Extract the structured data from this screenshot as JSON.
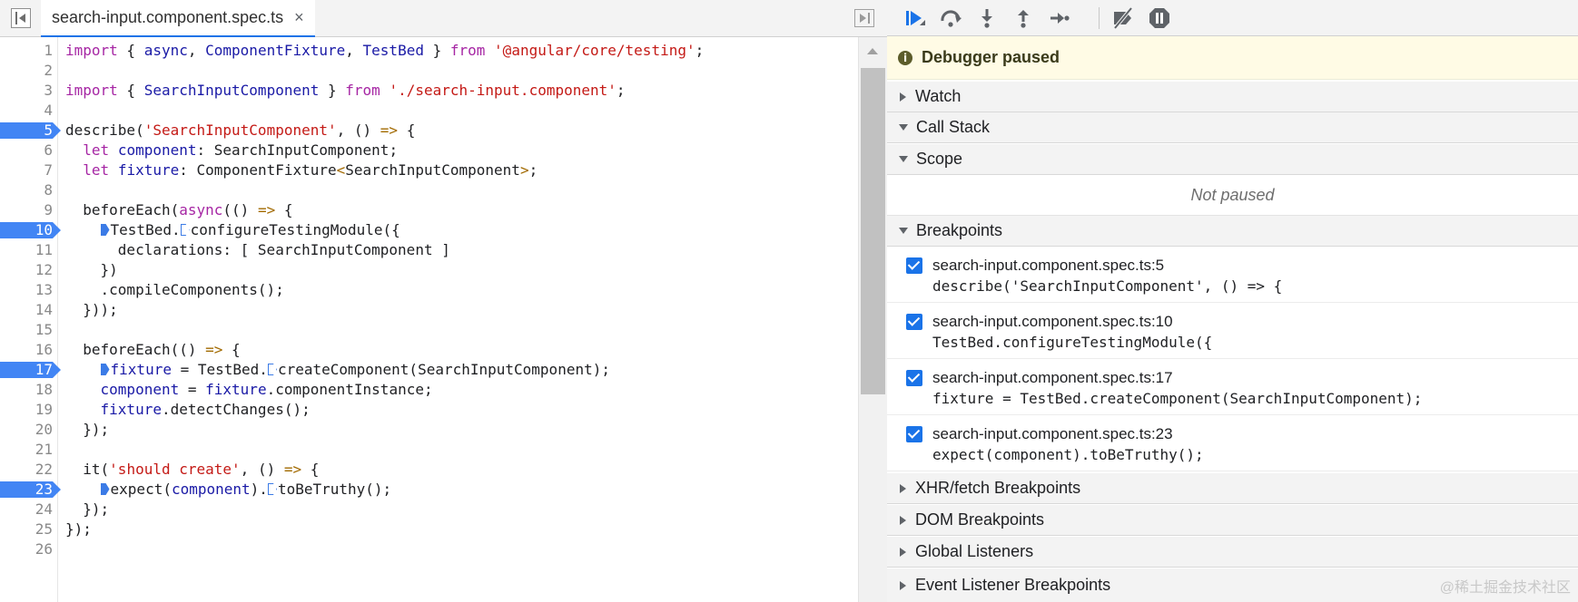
{
  "editor": {
    "tab_name": "search-input.component.spec.ts",
    "close_glyph": "×"
  },
  "code_lines": [
    {
      "n": "1",
      "bp": false
    },
    {
      "n": "2",
      "bp": false
    },
    {
      "n": "3",
      "bp": false
    },
    {
      "n": "4",
      "bp": false
    },
    {
      "n": "5",
      "bp": true
    },
    {
      "n": "6",
      "bp": false
    },
    {
      "n": "7",
      "bp": false
    },
    {
      "n": "8",
      "bp": false
    },
    {
      "n": "9",
      "bp": false
    },
    {
      "n": "10",
      "bp": true
    },
    {
      "n": "11",
      "bp": false
    },
    {
      "n": "12",
      "bp": false
    },
    {
      "n": "13",
      "bp": false
    },
    {
      "n": "14",
      "bp": false
    },
    {
      "n": "15",
      "bp": false
    },
    {
      "n": "16",
      "bp": false
    },
    {
      "n": "17",
      "bp": true
    },
    {
      "n": "18",
      "bp": false
    },
    {
      "n": "19",
      "bp": false
    },
    {
      "n": "20",
      "bp": false
    },
    {
      "n": "21",
      "bp": false
    },
    {
      "n": "22",
      "bp": false
    },
    {
      "n": "23",
      "bp": true
    },
    {
      "n": "24",
      "bp": false
    },
    {
      "n": "25",
      "bp": false
    },
    {
      "n": "26",
      "bp": false
    }
  ],
  "code": {
    "l1": [
      [
        "kw",
        "import"
      ],
      [
        "t",
        " { "
      ],
      [
        "id",
        "async"
      ],
      [
        "t",
        ", "
      ],
      [
        "id",
        "ComponentFixture"
      ],
      [
        "t",
        ", "
      ],
      [
        "id",
        "TestBed"
      ],
      [
        "t",
        " } "
      ],
      [
        "kw",
        "from"
      ],
      [
        "t",
        " "
      ],
      [
        "str",
        "'@angular/core/testing'"
      ],
      [
        "t",
        ";"
      ]
    ],
    "l3": [
      [
        "kw",
        "import"
      ],
      [
        "t",
        " { "
      ],
      [
        "id",
        "SearchInputComponent"
      ],
      [
        "t",
        " } "
      ],
      [
        "kw",
        "from"
      ],
      [
        "t",
        " "
      ],
      [
        "str",
        "'./search-input.component'"
      ],
      [
        "t",
        ";"
      ]
    ],
    "l5": [
      [
        "t",
        "describe("
      ],
      [
        "str",
        "'SearchInputComponent'"
      ],
      [
        "t",
        ", () "
      ],
      [
        "ar",
        "=>"
      ],
      [
        "t",
        " {"
      ]
    ],
    "l6": [
      [
        "t",
        "  "
      ],
      [
        "kw",
        "let"
      ],
      [
        "t",
        " "
      ],
      [
        "id",
        "component"
      ],
      [
        "t",
        ": SearchInputComponent;"
      ]
    ],
    "l7": [
      [
        "t",
        "  "
      ],
      [
        "kw",
        "let"
      ],
      [
        "t",
        " "
      ],
      [
        "id",
        "fixture"
      ],
      [
        "t",
        ": ComponentFixture"
      ],
      [
        "ar",
        "<"
      ],
      [
        "t",
        "SearchInputComponent"
      ],
      [
        "ar",
        ">"
      ],
      [
        "t",
        ";"
      ]
    ],
    "l9": [
      [
        "t",
        "  beforeEach("
      ],
      [
        "kw",
        "async"
      ],
      [
        "t",
        "(() "
      ],
      [
        "ar",
        "=>"
      ],
      [
        "t",
        " {"
      ]
    ],
    "l10": [
      [
        "t",
        "    "
      ],
      [
        "mkf",
        ""
      ],
      [
        "t",
        "TestBed."
      ],
      [
        "mko",
        ""
      ],
      [
        "t",
        "configureTestingModule({"
      ]
    ],
    "l11": [
      [
        "t",
        "      declarations: [ SearchInputComponent ]"
      ]
    ],
    "l12": [
      [
        "t",
        "    })"
      ]
    ],
    "l13": [
      [
        "t",
        "    .compileComponents();"
      ]
    ],
    "l14": [
      [
        "t",
        "  }));"
      ]
    ],
    "l16": [
      [
        "t",
        "  beforeEach(() "
      ],
      [
        "ar",
        "=>"
      ],
      [
        "t",
        " {"
      ]
    ],
    "l17": [
      [
        "t",
        "    "
      ],
      [
        "mkf",
        ""
      ],
      [
        "id",
        "fixture"
      ],
      [
        "t",
        " = TestBed."
      ],
      [
        "mko",
        ""
      ],
      [
        "t",
        "createComponent(SearchInputComponent);"
      ]
    ],
    "l18": [
      [
        "t",
        "    "
      ],
      [
        "id",
        "component"
      ],
      [
        "t",
        " = "
      ],
      [
        "id",
        "fixture"
      ],
      [
        "t",
        ".componentInstance;"
      ]
    ],
    "l19": [
      [
        "t",
        "    "
      ],
      [
        "id",
        "fixture"
      ],
      [
        "t",
        ".detectChanges();"
      ]
    ],
    "l20": [
      [
        "t",
        "  });"
      ]
    ],
    "l22": [
      [
        "t",
        "  it("
      ],
      [
        "str",
        "'should create'"
      ],
      [
        "t",
        ", () "
      ],
      [
        "ar",
        "=>"
      ],
      [
        "t",
        " {"
      ]
    ],
    "l23": [
      [
        "t",
        "    "
      ],
      [
        "mkf",
        ""
      ],
      [
        "t",
        "expect("
      ],
      [
        "id",
        "component"
      ],
      [
        "t",
        ")."
      ],
      [
        "mko",
        ""
      ],
      [
        "t",
        "toBeTruthy();"
      ]
    ],
    "l24": [
      [
        "t",
        "  });"
      ]
    ],
    "l25": [
      [
        "t",
        "});"
      ]
    ]
  },
  "debugger": {
    "toolbar": [
      "resume-icon",
      "step-over-icon",
      "step-into-icon",
      "step-out-icon",
      "step-icon",
      "deactivate-breakpoints-icon",
      "pause-on-exceptions-icon"
    ],
    "paused_info": "i",
    "paused_text": "Debugger paused",
    "sections": {
      "watch": "Watch",
      "call_stack": "Call Stack",
      "scope": "Scope",
      "breakpoints": "Breakpoints",
      "xhr": "XHR/fetch Breakpoints",
      "dom": "DOM Breakpoints",
      "global": "Global Listeners",
      "event": "Event Listener Breakpoints"
    },
    "scope_empty": "Not paused",
    "breakpoints": [
      {
        "location": "search-input.component.spec.ts:5",
        "source": "describe('SearchInputComponent', () => {",
        "checked": true
      },
      {
        "location": "search-input.component.spec.ts:10",
        "source": "TestBed.configureTestingModule({",
        "checked": true
      },
      {
        "location": "search-input.component.spec.ts:17",
        "source": "fixture = TestBed.createComponent(SearchInputComponent);",
        "checked": true
      },
      {
        "location": "search-input.component.spec.ts:23",
        "source": "expect(component).toBeTruthy();",
        "checked": true
      }
    ]
  },
  "watermark": "@稀土掘金技术社区",
  "colors": {
    "accent": "#1a73e8",
    "breakpoint": "#4285f4",
    "keyword": "#a626a4",
    "string": "#c41a16",
    "identifier": "#1a1aa6"
  }
}
